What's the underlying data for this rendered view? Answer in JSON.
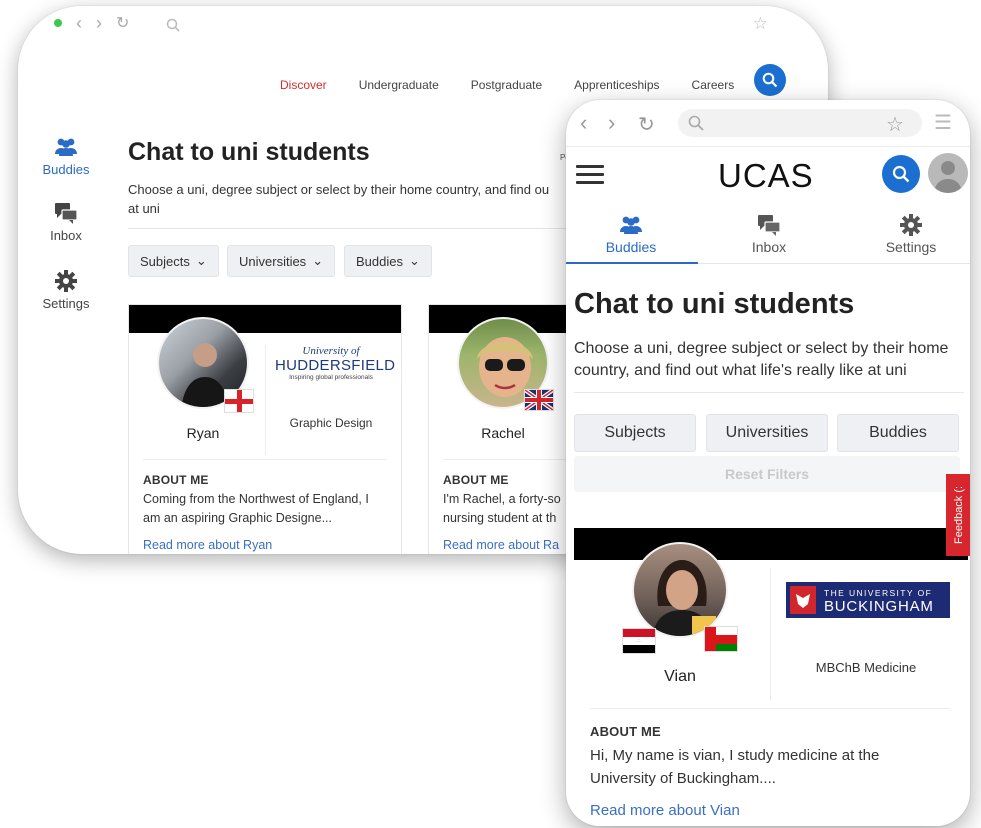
{
  "desktop": {
    "nav": [
      "Discover",
      "Undergraduate",
      "Postgraduate",
      "Apprenticeships",
      "Careers"
    ],
    "sidebar": [
      {
        "label": "Buddies",
        "icon": "people-icon",
        "active": true
      },
      {
        "label": "Inbox",
        "icon": "chat-icon",
        "active": false
      },
      {
        "label": "Settings",
        "icon": "gear-icon",
        "active": false
      }
    ],
    "title": "Chat to uni students",
    "description": "Choose a uni, degree subject or select by their home country, and find ou",
    "description_cont": "at uni",
    "fragment": "Po",
    "filters": [
      "Subjects",
      "Universities",
      "Buddies"
    ],
    "cards": [
      {
        "name": "Ryan",
        "uni_small": "University of",
        "uni_big": "HUDDERSFIELD",
        "uni_tag": "Inspiring global professionals",
        "course": "Graphic Design",
        "about_heading": "ABOUT ME",
        "about_line1": "Coming from the Northwest of England, I",
        "about_line2": "am an aspiring Graphic Designe...",
        "read_more": "Read more about Ryan"
      },
      {
        "name": "Rachel",
        "about_heading": "ABOUT ME",
        "about_line1": "I'm Rachel, a forty-so",
        "about_line2": "nursing student at th",
        "read_more": "Read more about Ra"
      }
    ]
  },
  "mobile": {
    "logo": "UCAS",
    "tabs": [
      {
        "label": "Buddies",
        "icon": "people-icon",
        "active": true
      },
      {
        "label": "Inbox",
        "icon": "chat-icon",
        "active": false
      },
      {
        "label": "Settings",
        "icon": "gear-icon",
        "active": false
      }
    ],
    "title": "Chat to uni students",
    "description_line1": "Choose a uni, degree subject or select by their home",
    "description_line2": "country, and find out what life's really like at uni",
    "filters": [
      "Subjects",
      "Universities",
      "Buddies"
    ],
    "reset": "Reset Filters",
    "feedback": "Feedback (:",
    "card": {
      "name": "Vian",
      "uni_small": "THE UNIVERSITY OF",
      "uni_big": "BUCKINGHAM",
      "course": "MBChB Medicine",
      "about_heading": "ABOUT ME",
      "about_line1": "Hi, My name is vian, I study medicine at the",
      "about_line2": "University of Buckingham....",
      "read_more": "Read more about Vian"
    }
  },
  "colors": {
    "accent_blue": "#1b6fd1",
    "active_nav_red": "#d52d2d",
    "link_blue": "#3a6fc1",
    "feedback_red": "#d8262e",
    "buckingham_navy": "#1d2a74"
  }
}
